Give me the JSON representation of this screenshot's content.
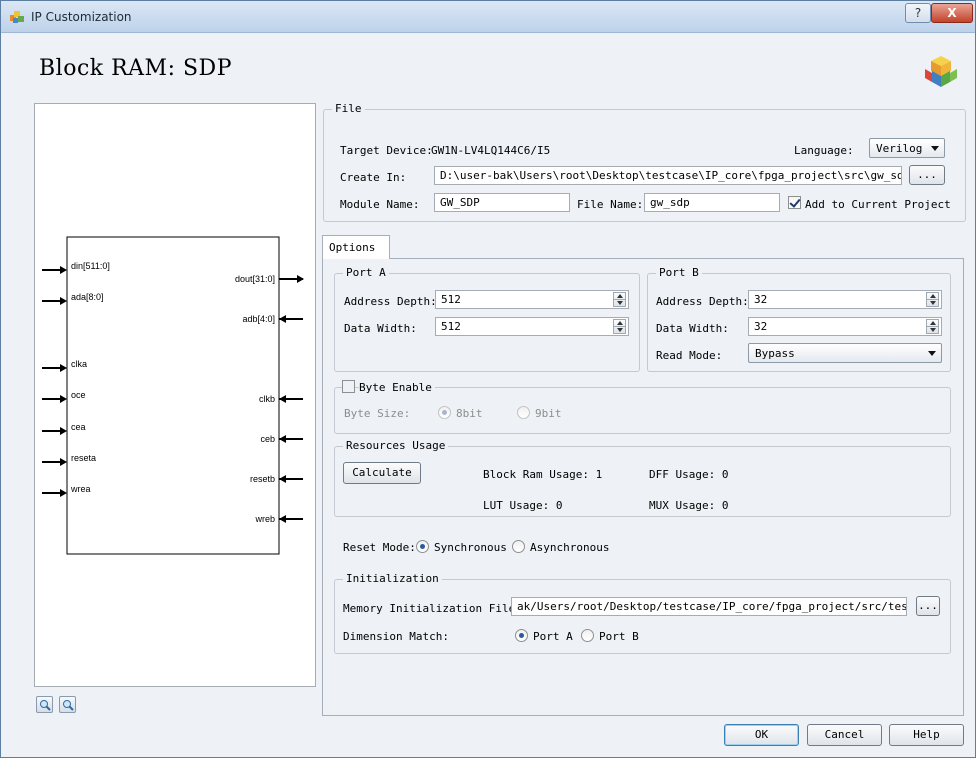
{
  "window": {
    "title": "IP Customization",
    "help_glyph": "?",
    "close_glyph": "X"
  },
  "page_title": "Block RAM: SDP",
  "diagram": {
    "inputs": [
      "din[511:0]",
      "ada[8:0]",
      "clka",
      "oce",
      "cea",
      "reseta",
      "wrea"
    ],
    "outputs": [
      "dout[31:0]",
      "adb[4:0]",
      "clkb",
      "ceb",
      "resetb",
      "wreb"
    ]
  },
  "file": {
    "group_title": "File",
    "target_device_label": "Target Device:",
    "target_device_value": "GW1N-LV4LQ144C6/I5",
    "language_label": "Language:",
    "language_value": "Verilog",
    "create_in_label": "Create In:",
    "create_in_value": "D:\\user-bak\\Users\\root\\Desktop\\testcase\\IP_core\\fpga_project\\src\\gw_sdp",
    "browse_label": "...",
    "module_name_label": "Module Name:",
    "module_name_value": "GW_SDP",
    "file_name_label": "File Name:",
    "file_name_value": "gw_sdp",
    "add_to_project_label": "Add to Current Project",
    "add_to_project_checked": true
  },
  "tabs": [
    {
      "label": "Options"
    }
  ],
  "port_a": {
    "title": "Port A",
    "address_depth_label": "Address Depth:",
    "address_depth_value": "512",
    "data_width_label": "Data Width:",
    "data_width_value": "512"
  },
  "port_b": {
    "title": "Port B",
    "address_depth_label": "Address Depth:",
    "address_depth_value": "32",
    "data_width_label": "Data Width:",
    "data_width_value": "32",
    "read_mode_label": "Read Mode:",
    "read_mode_value": "Bypass"
  },
  "byte_enable": {
    "label": "Byte Enable",
    "checked": false,
    "byte_size_label": "Byte Size:",
    "opt_8bit": "8bit",
    "opt_9bit": "9bit"
  },
  "resources": {
    "title": "Resources Usage",
    "calculate_label": "Calculate",
    "block_ram_usage": "Block Ram Usage: 1",
    "dff_usage": "DFF Usage: 0",
    "lut_usage": "LUT Usage: 0",
    "mux_usage": "MUX Usage: 0"
  },
  "reset_mode": {
    "label": "Reset Mode:",
    "opt_sync": "Synchronous",
    "opt_async": "Asynchronous",
    "selected": "Synchronous"
  },
  "initialization": {
    "title": "Initialization",
    "file_label": "Memory Initialization File:",
    "file_value": "ak/Users/root/Desktop/testcase/IP_core/fpga_project/src/test.mi",
    "browse_label": "...",
    "dimension_label": "Dimension Match:",
    "opt_port_a": "Port A",
    "opt_port_b": "Port B"
  },
  "buttons": {
    "ok": "OK",
    "cancel": "Cancel",
    "help": "Help"
  }
}
